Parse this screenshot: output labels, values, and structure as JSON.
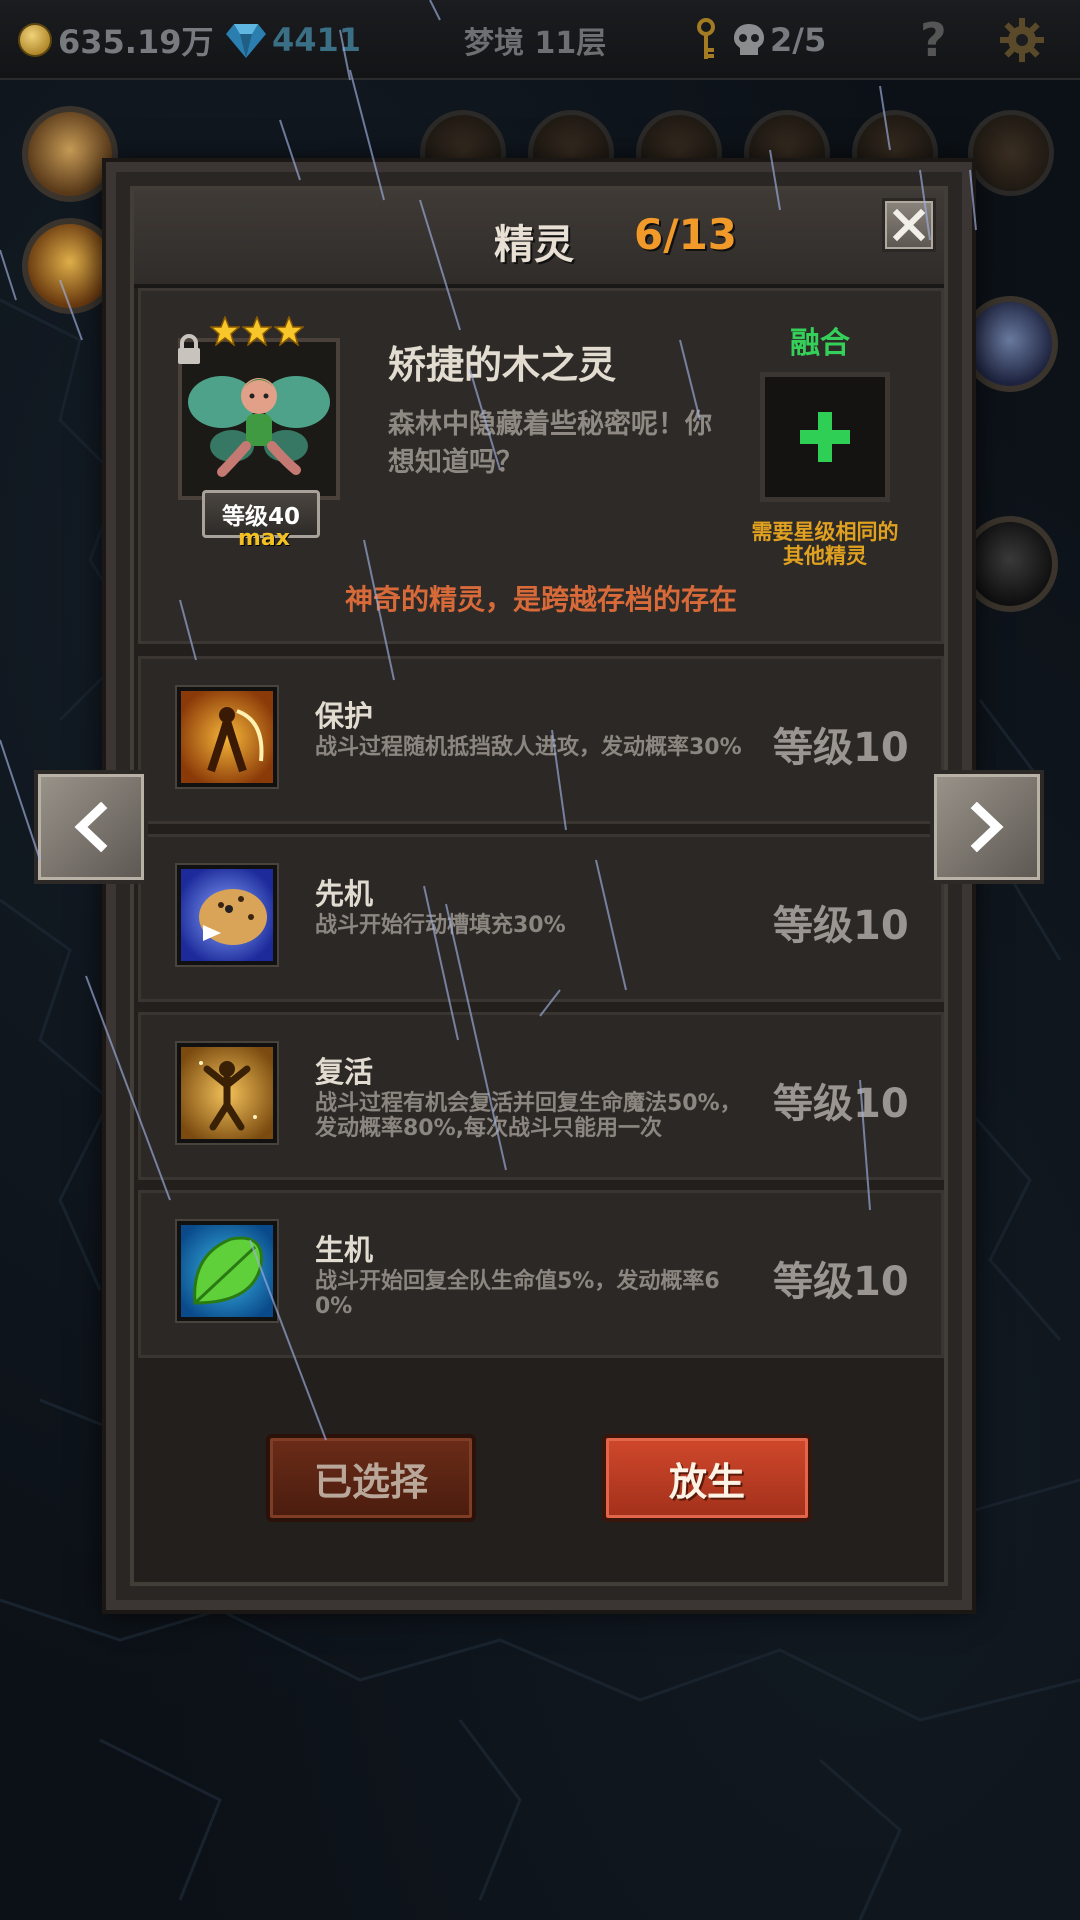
{
  "hud": {
    "gold": "635.19万",
    "gems": "4411",
    "floor": "梦境 11层",
    "keys_icon": "key-icon",
    "skulls": "2/5",
    "help": "?"
  },
  "dialog": {
    "title": "精灵",
    "count": "6/13",
    "fairy": {
      "stars": 3,
      "level": "等级40",
      "max_label": "max",
      "name": "矫捷的木之灵",
      "desc": "森林中隐藏着些秘密呢！你想知道吗？",
      "locked": true
    },
    "fusion": {
      "label": "融合",
      "note": "需要星级相同的其他精灵"
    },
    "tagline": "神奇的精灵，是跨越存档的存在",
    "skills": [
      {
        "name": "保护",
        "desc": "战斗过程随机抵挡敌人进攻，发动概率30%",
        "level": "等级10",
        "icon": "guard-icon"
      },
      {
        "name": "先机",
        "desc": "战斗开始行动槽填充30%",
        "level": "等级10",
        "icon": "leopard-icon"
      },
      {
        "name": "复活",
        "desc": "战斗过程有机会复活并回复生命魔法50%，发动概率80%,每次战斗只能用一次",
        "level": "等级10",
        "icon": "revive-icon"
      },
      {
        "name": "生机",
        "desc": "战斗开始回复全队生命值5%，发动概率60%",
        "level": "等级10",
        "icon": "leaf-icon"
      }
    ],
    "buttons": {
      "selected": "已选择",
      "release": "放生"
    }
  },
  "colors": {
    "accent_orange": "#f19a2a",
    "fusion_green": "#34d05a",
    "tagline_red": "#d86a3a",
    "release_red": "#c03c22"
  }
}
